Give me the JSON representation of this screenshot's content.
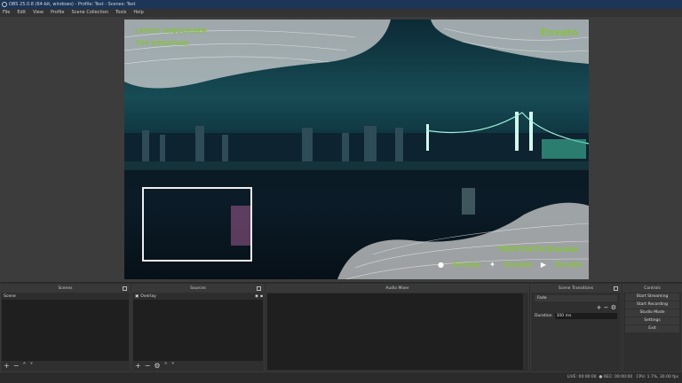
{
  "window": {
    "title": "OBS 25.0.8 (64-bit, windows) - Profile: Test - Scenes: Test"
  },
  "menu": [
    "File",
    "Edit",
    "View",
    "Profile",
    "Scene Collection",
    "Tools",
    "Help"
  ],
  "overlay": {
    "latest_subscriber": "LATEST SUBSCRIBER",
    "top_donation": "TOP DONATION",
    "brand": "Envato",
    "twitch": "TWITCHTV/Envato",
    "social": [
      {
        "icon": "facebook-icon",
        "label": "Envato"
      },
      {
        "icon": "twitter-icon",
        "label": "Envato"
      },
      {
        "icon": "youtube-icon",
        "label": "Envato"
      }
    ],
    "accent": "#86c23f"
  },
  "docks": {
    "scenes": {
      "title": "Scenes",
      "items": [
        "Scene"
      ]
    },
    "sources": {
      "title": "Sources",
      "items": [
        "Overlay"
      ]
    },
    "audio": {
      "title": "Audio Mixer"
    },
    "transitions": {
      "title": "Scene Transitions",
      "selected": "Fade",
      "duration_label": "Duration",
      "duration_value": "300 ms"
    },
    "controls": {
      "title": "Controls",
      "buttons": [
        "Start Streaming",
        "Start Recording",
        "Studio Mode",
        "Settings",
        "Exit"
      ]
    }
  },
  "status": {
    "live": "LIVE: 00:00:00",
    "rec": "REC: 00:00:00",
    "cpu": "CPU: 1.7%, 30.00 fps"
  }
}
